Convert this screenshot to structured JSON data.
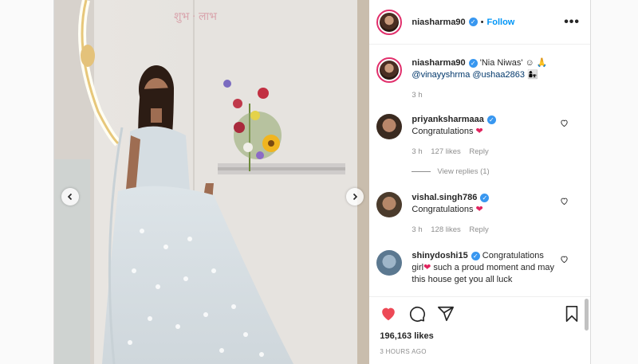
{
  "post": {
    "username": "niasharma90",
    "follow_label": "Follow",
    "more_label": "•••"
  },
  "caption": {
    "username": "niasharma90",
    "text": "'Nia Niwas' ☺ 🙏",
    "mentions": "@vinayyshrma @ushaa2863 👩‍👧",
    "time": "3 h"
  },
  "comments": [
    {
      "username": "priyanksharmaaa",
      "text": "Congratulations",
      "time": "3 h",
      "likes": "127 likes",
      "reply": "Reply",
      "view_replies": "View replies (1)"
    },
    {
      "username": "vishal.singh786",
      "text": "Congratulations",
      "time": "3 h",
      "likes": "128 likes",
      "reply": "Reply"
    },
    {
      "username": "shinydoshi15",
      "text": "Congratulations girl",
      "text2": " such a proud moment and may this house get you all luck"
    }
  ],
  "stats": {
    "likes": "196,163 likes",
    "posted": "3 HOURS AGO"
  },
  "colors": {
    "heart_red": "#ed4956",
    "link_blue": "#0095f6",
    "verified_blue": "#3897f0"
  }
}
